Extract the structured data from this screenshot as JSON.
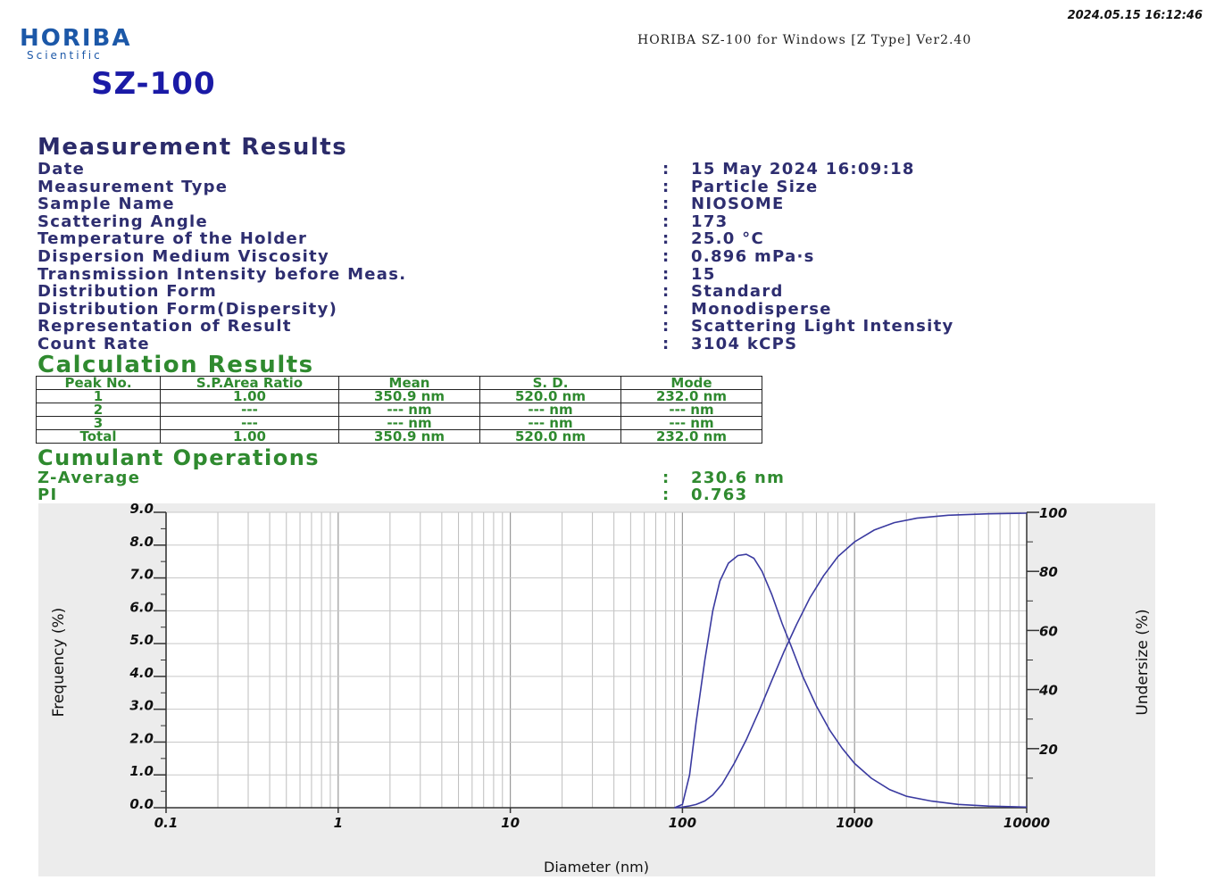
{
  "timestamp": "2024.05.15 16:12:46",
  "logo": {
    "main": "HORIBA",
    "sub": "Scientific"
  },
  "software": "HORIBA SZ-100 for Windows [Z Type] Ver2.40",
  "model": "SZ-100",
  "measurement": {
    "title": "Measurement Results",
    "rows": [
      {
        "label": "Date",
        "value": "15 May 2024 16:09:18"
      },
      {
        "label": "Measurement Type",
        "value": "Particle Size"
      },
      {
        "label": "Sample Name",
        "value": "NIOSOME"
      },
      {
        "label": "Scattering Angle",
        "value": "173"
      },
      {
        "label": "Temperature of the Holder",
        "value": "25.0 °C"
      },
      {
        "label": "Dispersion Medium Viscosity",
        "value": "0.896 mPa·s"
      },
      {
        "label": "Transmission Intensity before Meas.",
        "value": "15"
      },
      {
        "label": "Distribution Form",
        "value": "Standard"
      },
      {
        "label": "Distribution Form(Dispersity)",
        "value": "Monodisperse"
      },
      {
        "label": "Representation of Result",
        "value": "Scattering Light Intensity"
      },
      {
        "label": "Count Rate",
        "value": "3104 kCPS"
      }
    ]
  },
  "calculation": {
    "title": "Calculation Results",
    "headers": [
      "Peak No.",
      "S.P.Area Ratio",
      "Mean",
      "S. D.",
      "Mode"
    ],
    "rows": [
      [
        "1",
        "1.00",
        "350.9 nm",
        "520.0 nm",
        "232.0 nm"
      ],
      [
        "2",
        "---",
        "--- nm",
        "--- nm",
        "--- nm"
      ],
      [
        "3",
        "---",
        "--- nm",
        "--- nm",
        "--- nm"
      ],
      [
        "Total",
        "1.00",
        "350.9 nm",
        "520.0 nm",
        "232.0 nm"
      ]
    ]
  },
  "cumulant": {
    "title": "Cumulant Operations",
    "rows": [
      {
        "label": "Z-Average",
        "value": "230.6 nm"
      },
      {
        "label": "PI",
        "value": "0.763"
      }
    ]
  },
  "chart_data": {
    "type": "line",
    "xlabel": "Diameter (nm)",
    "ylabel": "Frequency (%)",
    "y2label": "Undersize (%)",
    "xscale": "log",
    "xlim": [
      0.1,
      10000
    ],
    "ylim": [
      0,
      9
    ],
    "y2lim": [
      0,
      100
    ],
    "xticks": [
      "0.1",
      "1",
      "10",
      "100",
      "1000",
      "10000"
    ],
    "yticks": [
      "0.0",
      "1.0",
      "2.0",
      "3.0",
      "4.0",
      "5.0",
      "6.0",
      "7.0",
      "8.0",
      "9.0"
    ],
    "y2ticks": [
      "20",
      "40",
      "60",
      "80",
      "100"
    ],
    "grid": true,
    "line_color": "#3a3aa0",
    "series": [
      {
        "axis": "left",
        "points": [
          [
            90,
            0
          ],
          [
            100,
            0.1
          ],
          [
            110,
            1.0
          ],
          [
            120,
            2.6
          ],
          [
            135,
            4.5
          ],
          [
            150,
            6.0
          ],
          [
            165,
            6.9
          ],
          [
            185,
            7.45
          ],
          [
            210,
            7.68
          ],
          [
            235,
            7.72
          ],
          [
            260,
            7.6
          ],
          [
            290,
            7.2
          ],
          [
            330,
            6.5
          ],
          [
            380,
            5.6
          ],
          [
            430,
            4.9
          ],
          [
            500,
            4.0
          ],
          [
            600,
            3.1
          ],
          [
            720,
            2.35
          ],
          [
            850,
            1.8
          ],
          [
            1000,
            1.35
          ],
          [
            1250,
            0.9
          ],
          [
            1600,
            0.55
          ],
          [
            2000,
            0.35
          ],
          [
            2800,
            0.2
          ],
          [
            4000,
            0.1
          ],
          [
            6000,
            0.05
          ],
          [
            10000,
            0.02
          ]
        ]
      },
      {
        "axis": "right",
        "points": [
          [
            90,
            0
          ],
          [
            100,
            0.2
          ],
          [
            110,
            0.6
          ],
          [
            120,
            1.1
          ],
          [
            135,
            2.3
          ],
          [
            150,
            4.3
          ],
          [
            170,
            8.0
          ],
          [
            200,
            15.0
          ],
          [
            235,
            23.0
          ],
          [
            280,
            33.0
          ],
          [
            330,
            43.0
          ],
          [
            390,
            53.0
          ],
          [
            460,
            62.0
          ],
          [
            550,
            71.0
          ],
          [
            660,
            78.5
          ],
          [
            800,
            85.0
          ],
          [
            1000,
            90.0
          ],
          [
            1300,
            94.0
          ],
          [
            1700,
            96.5
          ],
          [
            2300,
            98.0
          ],
          [
            3500,
            99.0
          ],
          [
            6000,
            99.5
          ],
          [
            10000,
            99.7
          ]
        ]
      }
    ]
  }
}
